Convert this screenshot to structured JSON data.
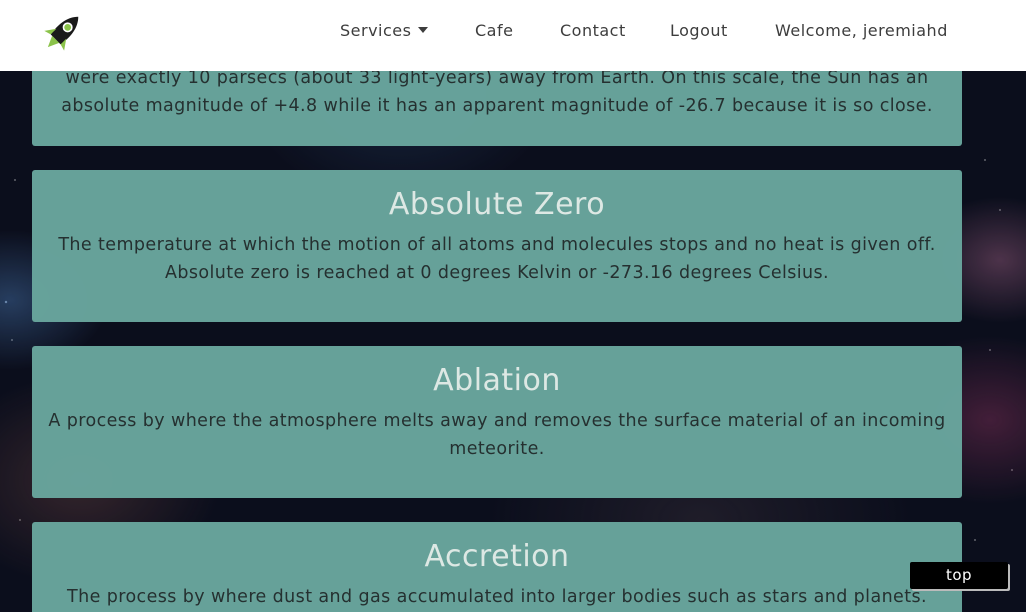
{
  "navbar": {
    "logo_icon": "rocket-icon",
    "services_label": "Services",
    "cafe_label": "Cafe",
    "contact_label": "Contact",
    "logout_label": "Logout",
    "welcome_text": "Welcome, jeremiahd"
  },
  "cards": [
    {
      "title": "",
      "lines": [
        "were exactly 10 parsecs (about 33 light-years) away from Earth. On this scale, the Sun has an",
        "absolute magnitude of +4.8 while it has an apparent magnitude of -26.7 because it is so close."
      ]
    },
    {
      "title": "Absolute Zero",
      "lines": [
        "The temperature at which the motion of all atoms and molecules stops and no heat is given off.",
        "Absolute zero is reached at 0 degrees Kelvin or -273.16 degrees Celsius."
      ]
    },
    {
      "title": "Ablation",
      "lines": [
        "A process by where the atmosphere melts away and removes the surface material of an incoming",
        "meteorite."
      ]
    },
    {
      "title": "Accretion",
      "lines": [
        "The process by where dust and gas accumulated into larger bodies such as stars and planets."
      ]
    }
  ],
  "top_button_label": "top",
  "colors": {
    "card_background": "#68a49c",
    "card_title": "#dde8e4",
    "navbar_background": "#ffffff",
    "logo_accent": "#8bc34a"
  }
}
